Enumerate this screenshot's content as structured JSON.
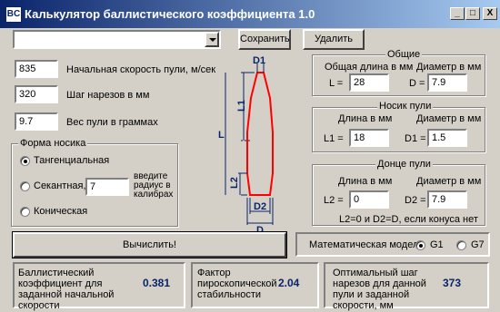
{
  "window": {
    "title": "Калькулятор баллистического коэффициента 1.0",
    "icon_text": "BC",
    "controls": {
      "minimize": "_",
      "maximize": "□",
      "close": "X"
    }
  },
  "toolbar": {
    "profile_value": "",
    "save_label": "Сохранить",
    "delete_label": "Удалить"
  },
  "inputs": {
    "muzzle_velocity": {
      "value": "835",
      "label": "Начальная скорость пули, м/сек"
    },
    "twist": {
      "value": "320",
      "label": "Шаг нарезов в мм"
    },
    "weight": {
      "value": "9.7",
      "label": "Вес пули в граммах"
    }
  },
  "nose_shape": {
    "title": "Форма носика",
    "options": [
      {
        "label": "Тангенциальная",
        "selected": true
      },
      {
        "label": "Секантная,",
        "selected": false
      },
      {
        "label": "Коническая",
        "selected": false
      }
    ],
    "radius_value": "7",
    "radius_hint": "введите радиус в калибрах"
  },
  "diagram": {
    "D1": "D1",
    "L1": "L1",
    "L": "L",
    "L2": "L2",
    "D2": "D2",
    "D": "D",
    "colors": {
      "bullet": "#ff0000",
      "dims": "#0a246a"
    }
  },
  "general": {
    "title": "Общие",
    "total_length_label": "Общая длина в мм",
    "diameter_label": "Диаметр в мм",
    "L_label": "L =",
    "L_value": "28",
    "D_label": "D =",
    "D_value": "7.9"
  },
  "nose": {
    "title": "Носик пули",
    "length_label": "Длина в мм",
    "diameter_label": "Диаметр в мм",
    "L1_label": "L1 =",
    "L1_value": "18",
    "D1_label": "D1 =",
    "D1_value": "1.5"
  },
  "base": {
    "title": "Донце пули",
    "length_label": "Длина в мм",
    "diameter_label": "Диаметр в мм",
    "L2_label": "L2 =",
    "L2_value": "0",
    "D2_label": "D2 =",
    "D2_value": "7.9",
    "note": "L2=0 и D2=D, если конуса нет"
  },
  "calculate_label": "Вычислить!",
  "model": {
    "label": "Математическая модель",
    "options": [
      {
        "label": "G1",
        "selected": true
      },
      {
        "label": "G7",
        "selected": false
      }
    ]
  },
  "results": {
    "bc": {
      "label": "Баллистический коэффициент для заданной начальной скорости",
      "value": "0.381"
    },
    "stability": {
      "label": "Фактор пироскопической стабильности",
      "value": "2.04"
    },
    "optimal_twist": {
      "label": "Оптимальный шаг нарезов для данной пули и заданной скорости, мм",
      "value": "373"
    }
  }
}
